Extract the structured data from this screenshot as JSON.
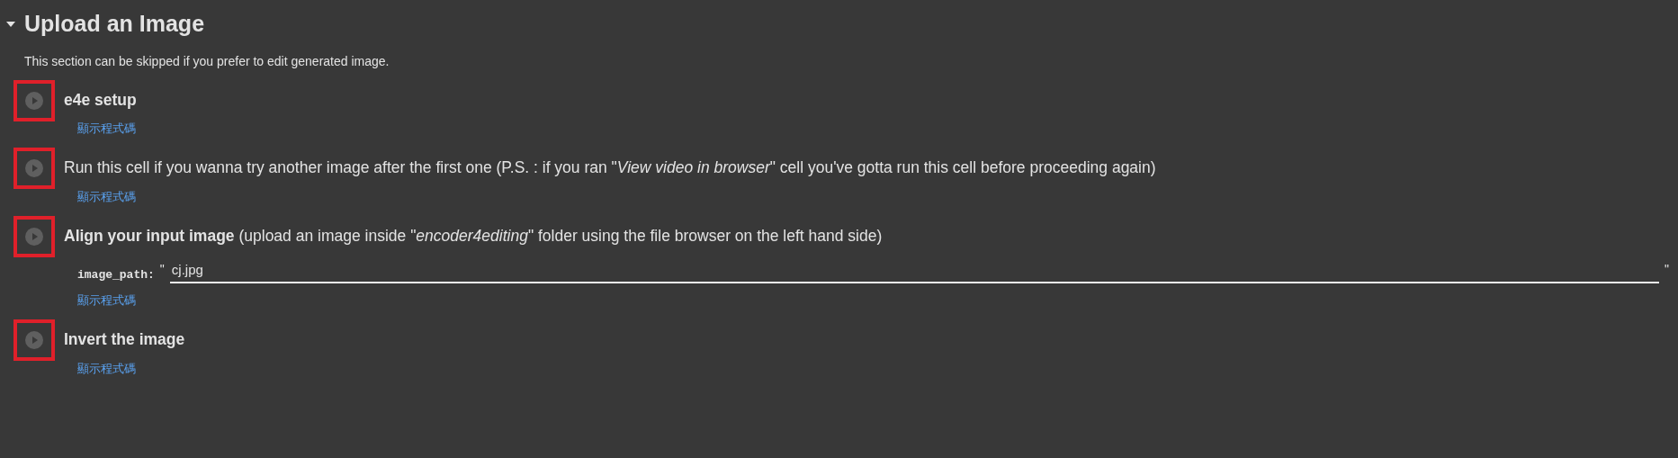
{
  "section": {
    "title": "Upload an Image",
    "expanded": true,
    "description": "This section can be skipped if you prefer to edit generated image."
  },
  "cells": [
    {
      "title": "e4e setup",
      "bold": true,
      "highlighted": true,
      "show_code": "顯示程式碼"
    },
    {
      "title": "Run this cell if you wanna try another image after the first one (P.S. : if you ran \"*View video in browser*\" cell you've gotta run this cell before proceeding again)",
      "bold": false,
      "highlighted": true,
      "show_code": "顯示程式碼"
    },
    {
      "title": "**Align your input image** (upload an image inside \"*encoder4editing*\" folder using the file browser on the left hand side)",
      "bold": false,
      "highlighted": true,
      "field": {
        "label": "image_path:",
        "open_quote": "\"",
        "value": "cj.jpg",
        "close_quote": "\""
      },
      "show_code": "顯示程式碼"
    },
    {
      "title": "Invert the image",
      "bold": true,
      "highlighted": true,
      "show_code": "顯示程式碼"
    }
  ]
}
